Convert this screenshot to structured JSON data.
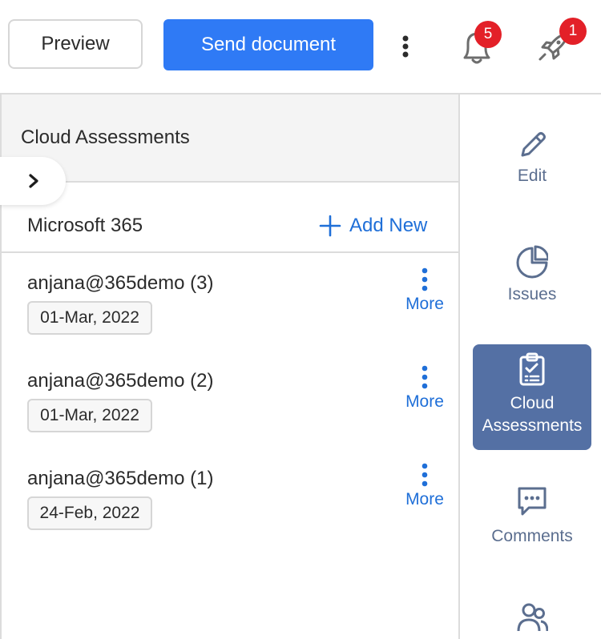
{
  "toolbar": {
    "preview_label": "Preview",
    "send_label": "Send document",
    "notifications_count": "5",
    "rocket_count": "1",
    "colors": {
      "primary": "#2f7af5",
      "badge": "#e32028"
    }
  },
  "panel": {
    "title": "Cloud Assessments",
    "section": "Microsoft 365",
    "add_new_label": "Add New",
    "items": [
      {
        "title": "anjana@365demo (3)",
        "date": "01-Mar, 2022",
        "more_label": "More"
      },
      {
        "title": "anjana@365demo (2)",
        "date": "01-Mar, 2022",
        "more_label": "More"
      },
      {
        "title": "anjana@365demo (1)",
        "date": "24-Feb, 2022",
        "more_label": "More"
      }
    ]
  },
  "nav": {
    "edit": "Edit",
    "issues": "Issues",
    "cloud_line1": "Cloud",
    "cloud_line2": "Assessments",
    "comments": "Comments",
    "colors": {
      "icon": "#5b6e8f",
      "active_bg": "#5470a4",
      "link": "#1f6fd8"
    }
  }
}
